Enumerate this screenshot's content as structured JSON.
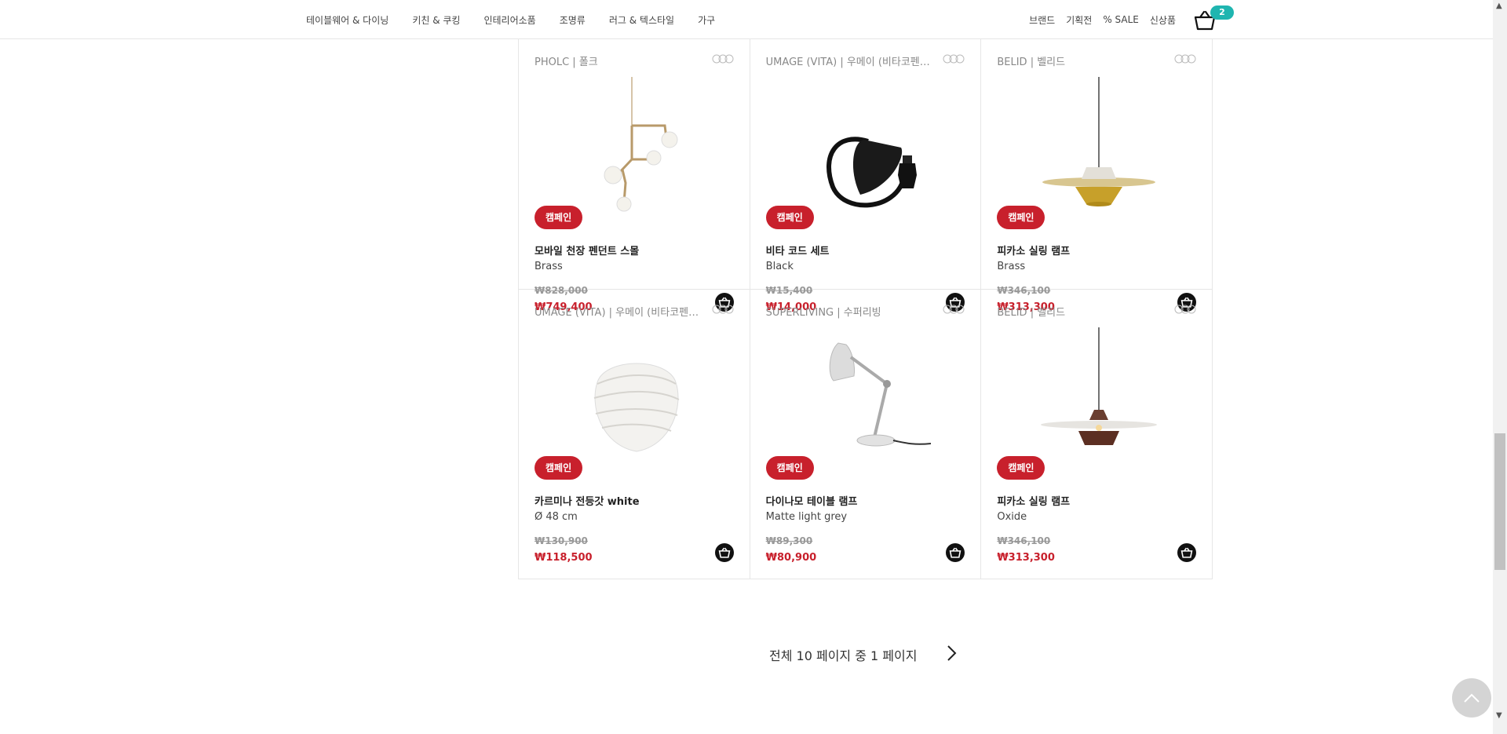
{
  "nav": {
    "categories": [
      "테이블웨어 & 다이닝",
      "키친 & 쿠킹",
      "인테리어소품",
      "조명류",
      "러그 & 텍스타일",
      "가구"
    ],
    "right": [
      "브랜드",
      "기획전",
      "% SALE",
      "신상품"
    ],
    "cart_count": "2"
  },
  "products": [
    {
      "brand": "PHOLC | 폴크",
      "badge": "캠페인",
      "name": "모바일 천장 펜던트 스몰",
      "variant": "Brass",
      "old_price": "₩828,000",
      "price": "₩749,400",
      "image": "mobile-pendant"
    },
    {
      "brand": "UMAGE (VITA) | 우메이 (비타코펜하...",
      "badge": "캠페인",
      "name": "비타 코드 세트",
      "variant": "Black",
      "old_price": "₩15,400",
      "price": "₩14,000",
      "image": "cord-set"
    },
    {
      "brand": "BELID | 벨리드",
      "badge": "캠페인",
      "name": "피카소 실링 램프",
      "variant": "Brass",
      "old_price": "₩346,100",
      "price": "₩313,300",
      "image": "picasso-brass"
    },
    {
      "brand": "UMAGE (VITA) | 우메이 (비타코펜하...",
      "badge": "캠페인",
      "name": "카르미나 전등갓 white",
      "variant": "Ø 48 cm",
      "old_price": "₩130,900",
      "price": "₩118,500",
      "image": "carmina-white"
    },
    {
      "brand": "SUPERLIVING | 수퍼리빙",
      "badge": "캠페인",
      "name": "다이나모 테이블 램프",
      "variant": "Matte light grey",
      "old_price": "₩89,300",
      "price": "₩80,900",
      "image": "dynamo-lamp"
    },
    {
      "brand": "BELID | 벨리드",
      "badge": "캠페인",
      "name": "피카소 실링 램프",
      "variant": "Oxide",
      "old_price": "₩346,100",
      "price": "₩313,300",
      "image": "picasso-oxide"
    }
  ],
  "pagination": {
    "text": "전체 10 페이지 중 1 페이지"
  },
  "colors": {
    "accent_red": "#c8202c",
    "badge_teal": "#1fb5b0"
  }
}
